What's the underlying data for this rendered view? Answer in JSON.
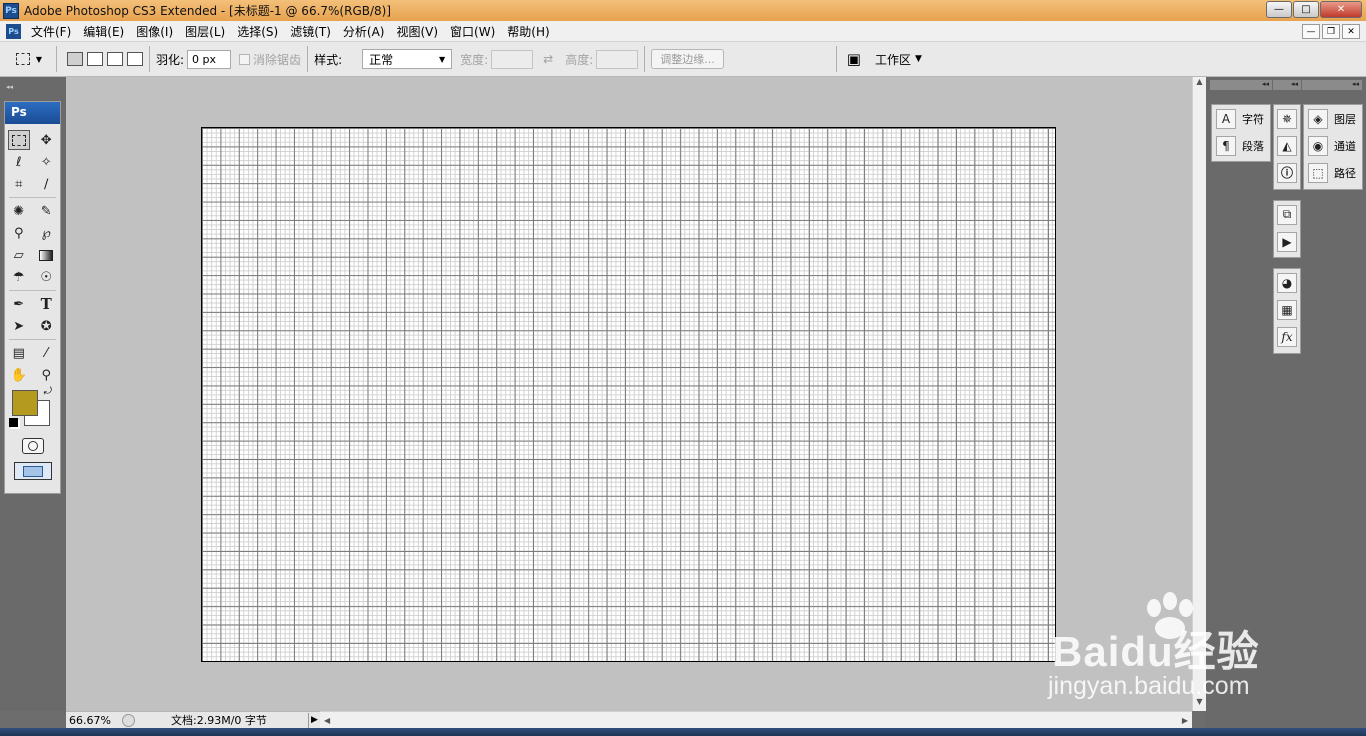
{
  "window": {
    "title": "Adobe Photoshop CS3 Extended - [未标题-1 @ 66.7%(RGB/8)]",
    "app_icon_label": "Ps",
    "buttons": {
      "minimize": "—",
      "maximize": "□",
      "close": "✕"
    }
  },
  "menu": {
    "items": [
      "文件(F)",
      "编辑(E)",
      "图像(I)",
      "图层(L)",
      "选择(S)",
      "滤镜(T)",
      "分析(A)",
      "视图(V)",
      "窗口(W)",
      "帮助(H)"
    ],
    "doc_buttons": {
      "minimize": "—",
      "restore": "❐",
      "close": "✕"
    }
  },
  "options": {
    "feather_label": "羽化:",
    "feather_value": "0 px",
    "antialias_label": "消除锯齿",
    "style_label": "样式:",
    "style_value": "正常",
    "width_label": "宽度:",
    "swap_glyph": "⇄",
    "height_label": "高度:",
    "refine_edge_label": "调整边缘...",
    "workspace_label": "工作区"
  },
  "toolbox": {
    "header": "Ps",
    "foreground_color": "#b49a1e",
    "background_color": "#ffffff"
  },
  "status": {
    "zoom": "66.67%",
    "doc_info": "文档:2.93M/0 字节"
  },
  "panels": {
    "group1": [
      {
        "icon": "character-icon",
        "glyph": "A",
        "label": "字符"
      },
      {
        "icon": "paragraph-icon",
        "glyph": "¶",
        "label": "段落"
      }
    ],
    "group3": [
      {
        "icon": "layers-icon",
        "glyph": "◈",
        "label": "图层"
      },
      {
        "icon": "channels-icon",
        "glyph": "◉",
        "label": "通道"
      },
      {
        "icon": "paths-icon",
        "glyph": "⬚",
        "label": "路径"
      }
    ]
  },
  "watermark": {
    "main": "Baidu经验",
    "sub": "jingyan.baidu.com"
  }
}
